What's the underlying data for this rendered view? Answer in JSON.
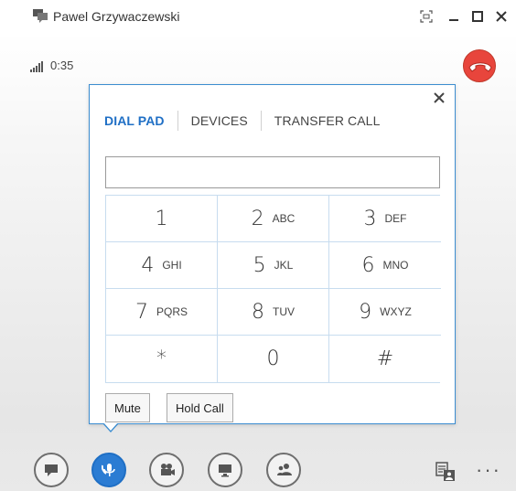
{
  "window": {
    "title": "Pawel Grzywaczewski"
  },
  "call": {
    "duration": "0:35"
  },
  "dialpad": {
    "tabs": [
      {
        "label": "DIAL PAD",
        "active": true
      },
      {
        "label": "DEVICES",
        "active": false
      },
      {
        "label": "TRANSFER CALL",
        "active": false
      }
    ],
    "input_value": "",
    "keys": [
      {
        "digit": "1",
        "letters": ""
      },
      {
        "digit": "2",
        "letters": "ABC"
      },
      {
        "digit": "3",
        "letters": "DEF"
      },
      {
        "digit": "4",
        "letters": "GHI"
      },
      {
        "digit": "5",
        "letters": "JKL"
      },
      {
        "digit": "6",
        "letters": "MNO"
      },
      {
        "digit": "7",
        "letters": "PQRS"
      },
      {
        "digit": "8",
        "letters": "TUV"
      },
      {
        "digit": "9",
        "letters": "WXYZ"
      },
      {
        "digit": "*",
        "letters": ""
      },
      {
        "digit": "0",
        "letters": ""
      },
      {
        "digit": "#",
        "letters": ""
      }
    ],
    "mute_label": "Mute",
    "hold_label": "Hold Call"
  },
  "toolbar": {
    "more_label": "···"
  },
  "colors": {
    "accent": "#1f6fc5",
    "hangup": "#e8453c",
    "popup_border": "#3c8dd0"
  }
}
